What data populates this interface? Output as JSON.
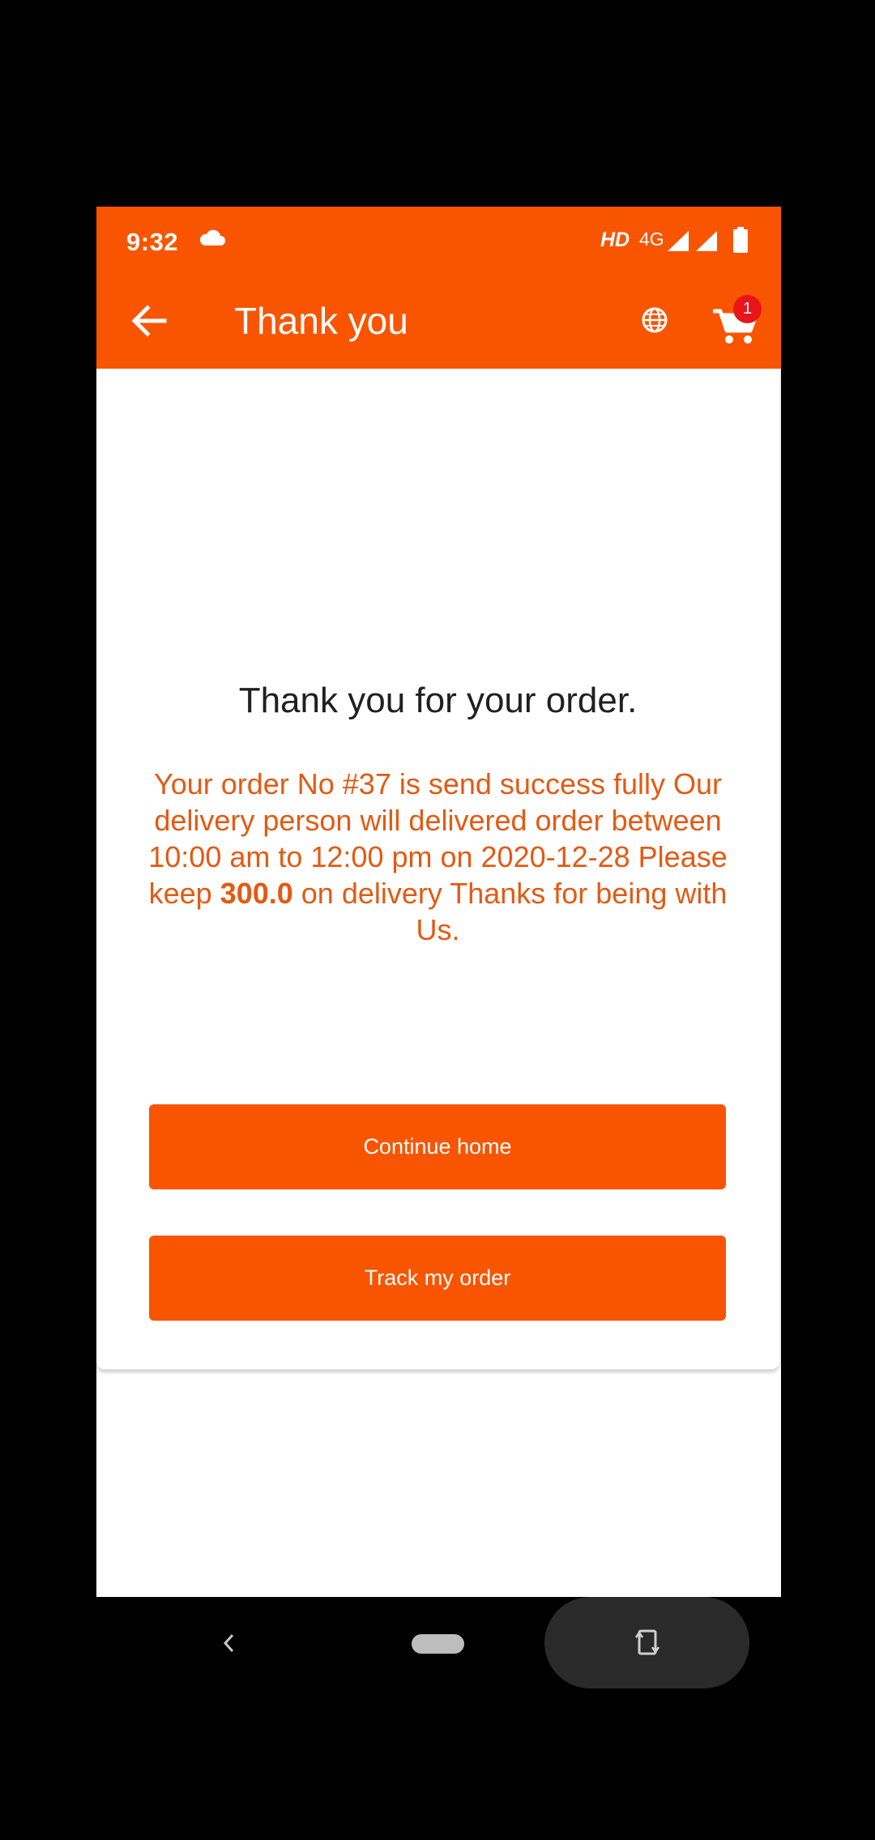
{
  "status_bar": {
    "time": "9:32",
    "hd_label": "HD",
    "network_label": "4G",
    "icons": [
      "cloud-icon",
      "signal-icon",
      "signal-icon",
      "battery-icon"
    ]
  },
  "app_bar": {
    "title": "Thank you",
    "back_icon": "arrow-left-icon",
    "language_icon": "globe-icon",
    "cart_icon": "cart-icon",
    "cart_badge_count": "1"
  },
  "main": {
    "heading": "Thank you for your order.",
    "message_part1": "Your order No #37 is send success fully Our delivery person will delivered order between 10:00 am to 12:00 pm on 2020-12-28 Please keep ",
    "message_amount": "300.0",
    "message_part2": " on delivery Thanks for being with Us.",
    "continue_button": "Continue home",
    "track_button": "Track my order"
  },
  "nav_bar": {
    "back_icon": "chevron-left-icon",
    "home_icon": "home-pill-icon",
    "rotate_icon": "rotate-screen-icon"
  },
  "colors": {
    "primary": "#f95500",
    "message_text": "#e35a12",
    "badge": "#e8151b"
  }
}
